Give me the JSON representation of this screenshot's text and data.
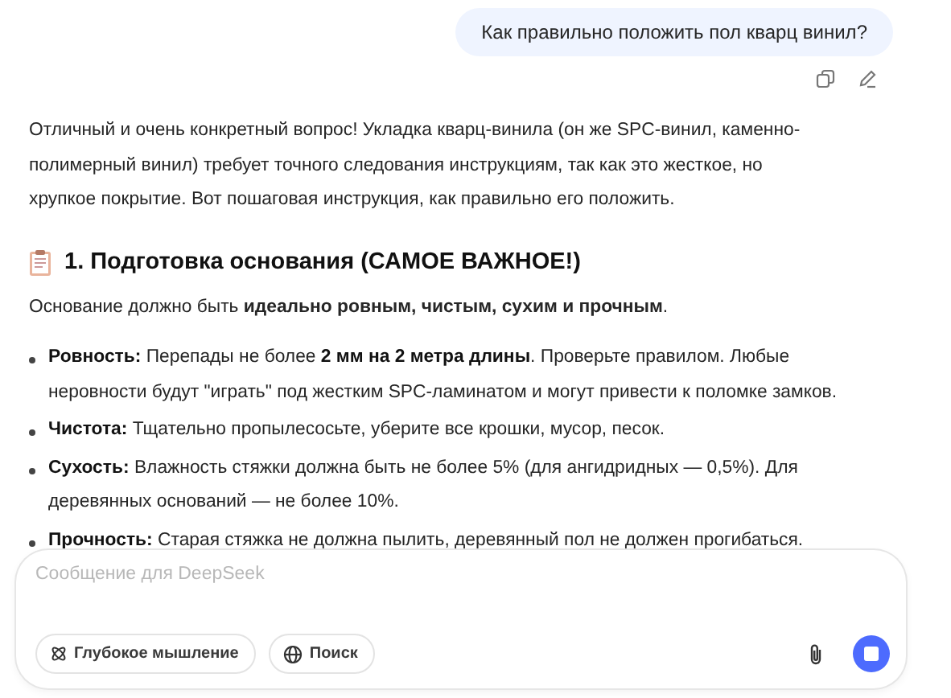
{
  "user_message": {
    "text": "Как правильно положить пол кварц винил?"
  },
  "answer": {
    "intro": "Отличный и очень конкретный вопрос! Укладка кварц-винила (он же SPC-винил, каменно-полимерный винил) требует точного следования инструкциям, так как это жесткое, но хрупкое покрытие. Вот пошаговая инструкция, как правильно его положить.",
    "heading": "1. Подготовка основания (САМОЕ ВАЖНОЕ!)",
    "lead": "Основание должно быть **идеально ровным, чистым, сухим и прочным**.",
    "bullets": [
      {
        "label": "Ровность:",
        "text": "Перепады не более **2 мм на 2 метра длины**. Проверьте правилом. Любые неровности будут \"играть\" под жестким SPC-ламинатом и могут привести к поломке замков."
      },
      {
        "label": "Чистота:",
        "text": "Тщательно пропылесосьте, уберите все крошки, мусор, песок."
      },
      {
        "label": "Сухость:",
        "text": "Влажность стяжки должна быть не более 5% (для ангидридных — 0,5%). Для деревянных оснований — не более 10%."
      },
      {
        "label": "Прочность:",
        "text": "Старая стяжка не должна пылить, деревянный пол не должен прогибаться."
      }
    ]
  },
  "composer": {
    "placeholder": "Сообщение для DeepSeek",
    "toggles": [
      {
        "kind": "think",
        "label": "Глубокое мышление",
        "on": false
      },
      {
        "kind": "search",
        "label": "Поиск",
        "on": false
      }
    ],
    "generating": true
  }
}
